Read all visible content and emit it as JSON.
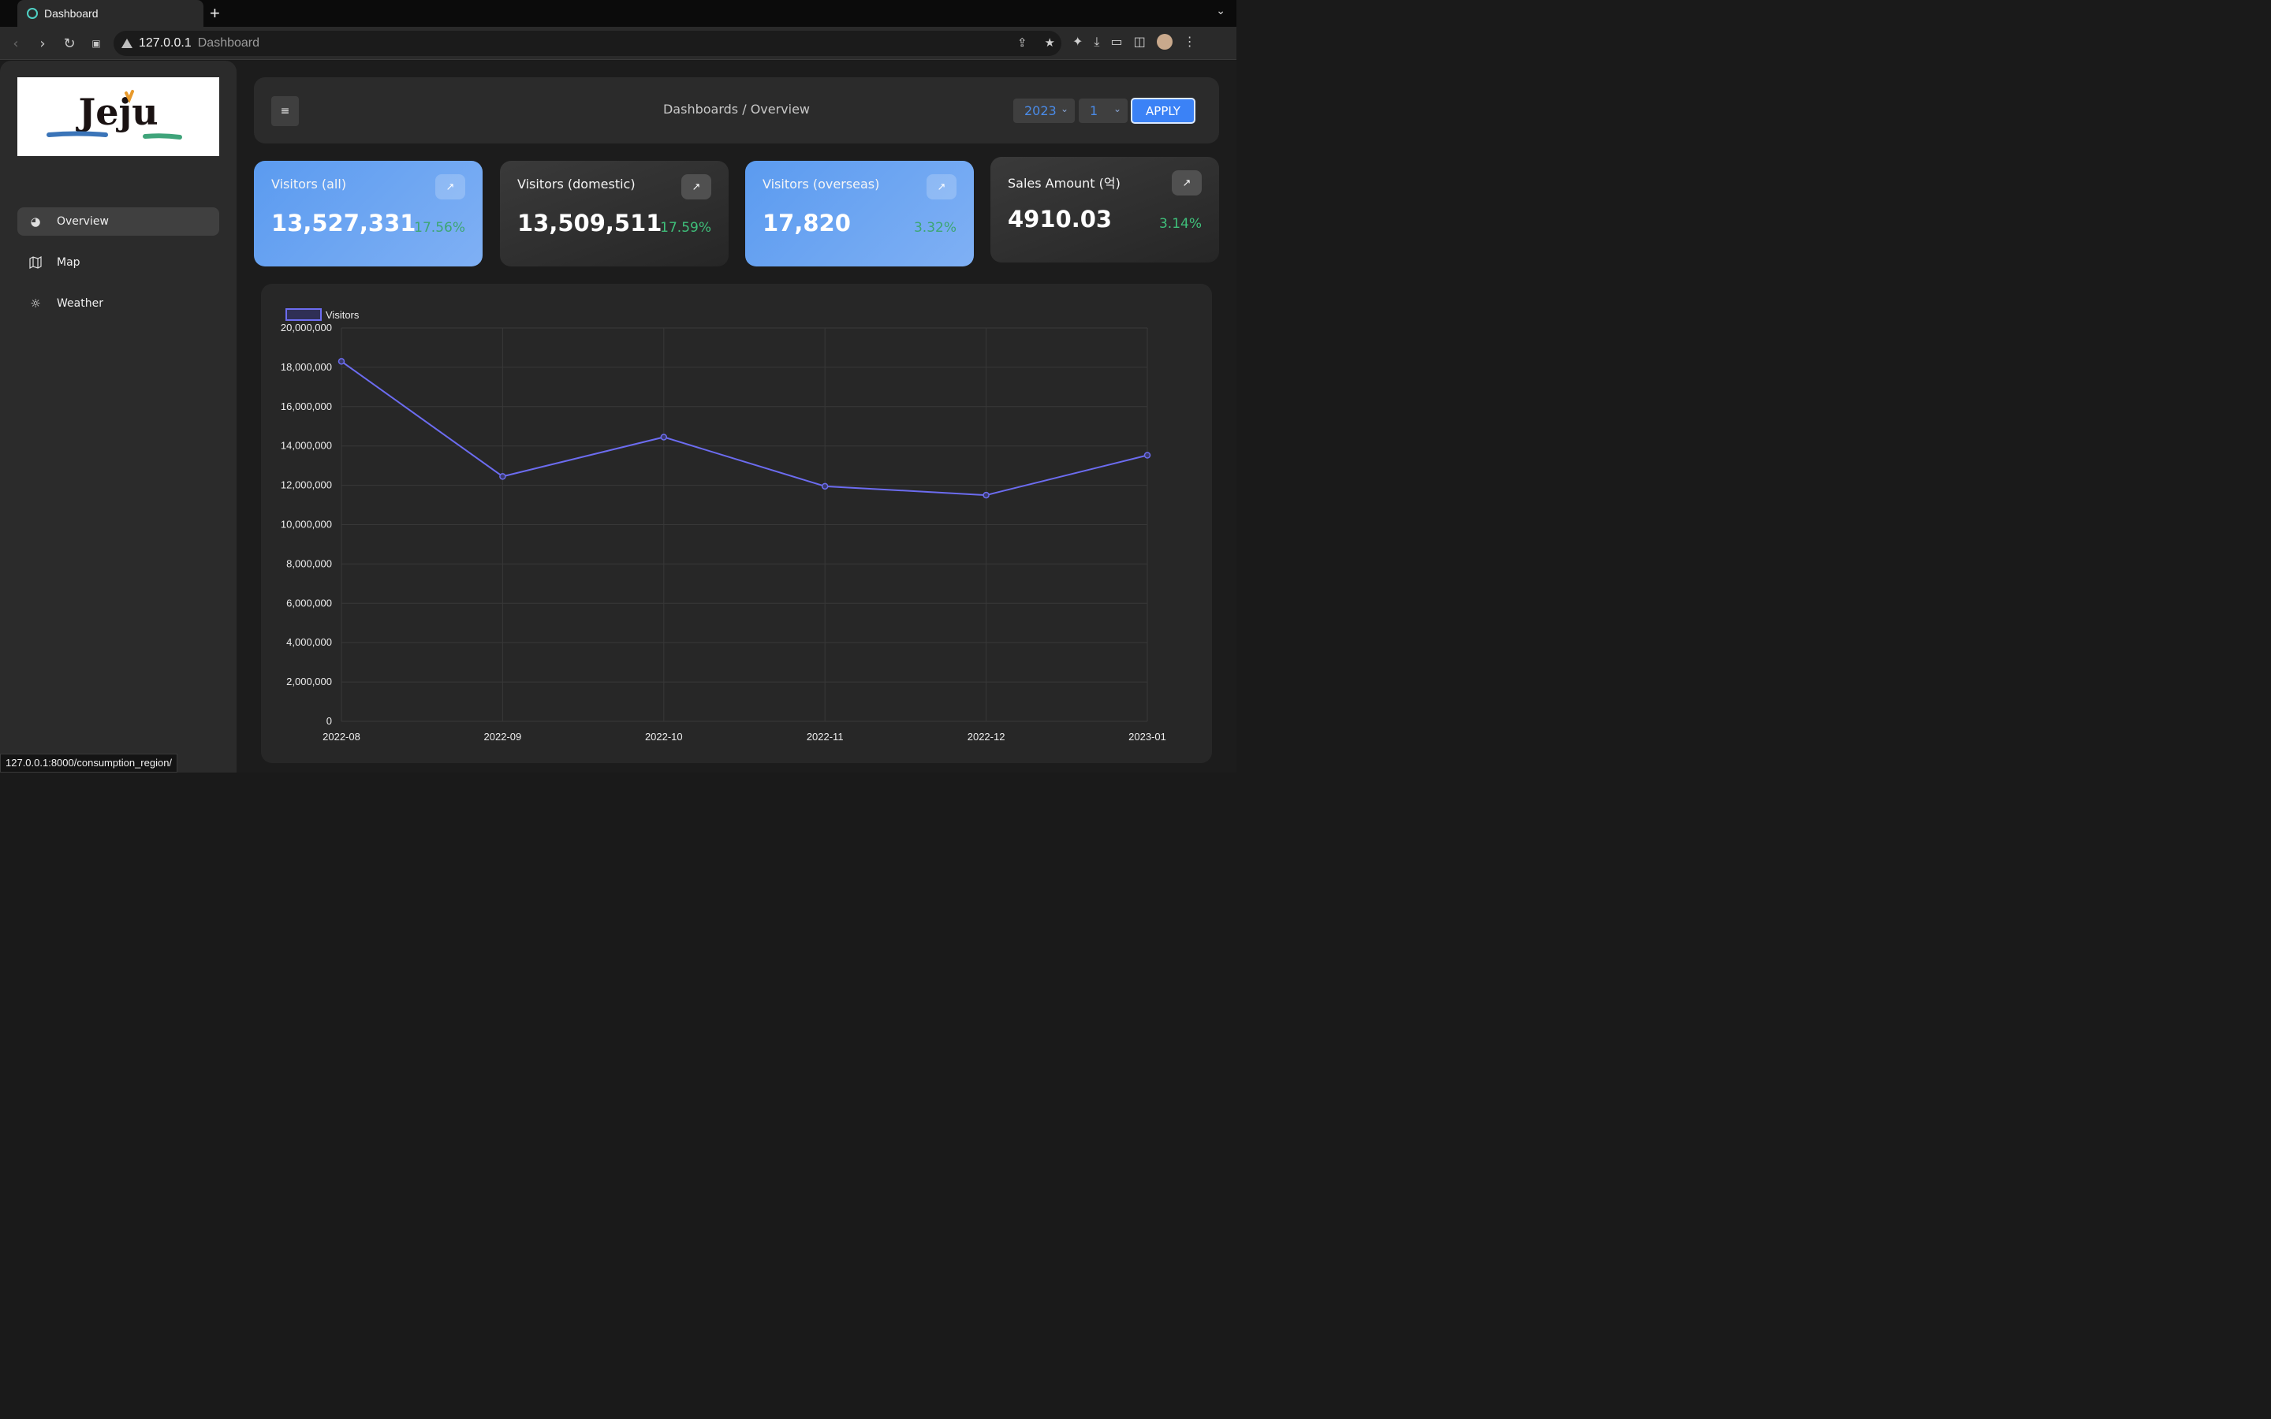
{
  "browser": {
    "tab_title": "Dashboard",
    "url_host": "127.0.0.1",
    "url_title": "Dashboard",
    "status_url": "127.0.0.1:8000/consumption_region/"
  },
  "sidebar": {
    "logo_text": "Jeju",
    "items": [
      {
        "label": "Overview",
        "icon": "pie-chart-icon",
        "active": true
      },
      {
        "label": "Map",
        "icon": "map-icon",
        "active": false
      },
      {
        "label": "Weather",
        "icon": "sun-icon",
        "active": false
      }
    ]
  },
  "header": {
    "breadcrumb": "Dashboards / Overview",
    "year_value": "2023",
    "month_value": "1",
    "apply_label": "APPLY"
  },
  "cards": [
    {
      "title": "Visitors (all)",
      "value": "13,527,331",
      "pct": "17.56%",
      "style": "blue"
    },
    {
      "title": "Visitors (domestic)",
      "value": "13,509,511",
      "pct": "17.59%",
      "style": "dark"
    },
    {
      "title": "Visitors (overseas)",
      "value": "17,820",
      "pct": "3.32%",
      "style": "blue"
    },
    {
      "title": "Sales Amount (억)",
      "value": "4910.03",
      "pct": "3.14%",
      "style": "dark"
    }
  ],
  "colors": {
    "accent": "#3b82f6",
    "line": "#6c6cf0",
    "positive": "#3fbf7a"
  },
  "chart_data": {
    "type": "line",
    "categories": [
      "2022-08",
      "2022-09",
      "2022-10",
      "2022-11",
      "2022-12",
      "2023-01"
    ],
    "series": [
      {
        "name": "Visitors",
        "values": [
          18300000,
          12450000,
          14450000,
          11950000,
          11500000,
          13527331
        ]
      }
    ],
    "ylim": [
      0,
      20000000
    ],
    "yticks": [
      "0",
      "2,000,000",
      "4,000,000",
      "6,000,000",
      "8,000,000",
      "10,000,000",
      "12,000,000",
      "14,000,000",
      "16,000,000",
      "18,000,000",
      "20,000,000"
    ],
    "legend_position": "top-left",
    "grid": true
  }
}
